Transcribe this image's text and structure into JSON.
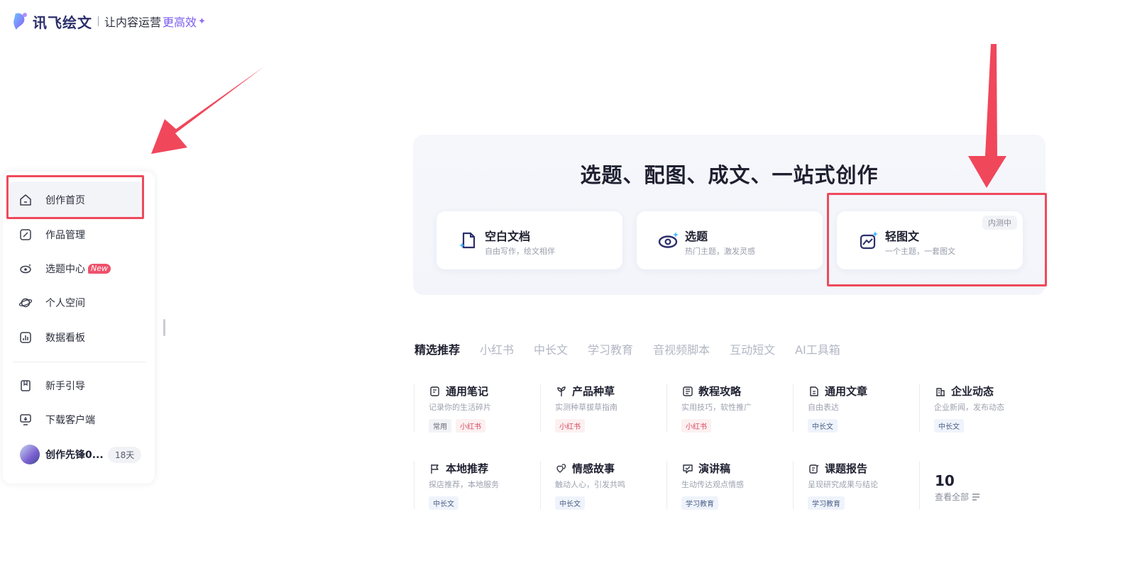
{
  "header": {
    "brand": "讯飞绘文",
    "slogan": "让内容运营",
    "slogan_highlight": "更高效",
    "sparkle": "✦"
  },
  "sidebar": {
    "items": [
      {
        "label": "创作首页",
        "icon": "home-icon",
        "active": true
      },
      {
        "label": "作品管理",
        "icon": "edit-icon"
      },
      {
        "label": "选题中心",
        "icon": "eye-sparkle-icon",
        "badge": "New"
      },
      {
        "label": "个人空间",
        "icon": "planet-icon"
      },
      {
        "label": "数据看板",
        "icon": "chart-icon"
      },
      {
        "label": "新手引导",
        "icon": "book-icon"
      },
      {
        "label": "下载客户端",
        "icon": "download-monitor-icon"
      }
    ],
    "user": {
      "name": "创作先锋0...",
      "days": "18天"
    }
  },
  "hero": {
    "title": "选题、配图、成文、一站式创作",
    "cards": [
      {
        "title": "空白文档",
        "subtitle": "自由写作，绘文相伴",
        "icon": "blank-doc-icon"
      },
      {
        "title": "选题",
        "subtitle": "热门主题，激发灵感",
        "icon": "eye-sparkle-icon"
      },
      {
        "title": "轻图文",
        "subtitle": "一个主题，一套图文",
        "icon": "image-sparkle-icon",
        "tag": "内测中"
      }
    ]
  },
  "tabs": [
    "精选推荐",
    "小红书",
    "中长文",
    "学习教育",
    "音视频脚本",
    "互动短文",
    "AI工具箱"
  ],
  "templates": [
    {
      "name": "通用笔记",
      "desc": "记录你的生活碎片",
      "tags": [
        {
          "t": "常用",
          "c": "gray"
        },
        {
          "t": "小红书",
          "c": "red"
        }
      ],
      "icon": "note-icon"
    },
    {
      "name": "产品种草",
      "desc": "实测种草拔草指南",
      "tags": [
        {
          "t": "小红书",
          "c": "red"
        }
      ],
      "icon": "sprout-icon"
    },
    {
      "name": "教程攻略",
      "desc": "实用技巧，软性推广",
      "tags": [
        {
          "t": "小红书",
          "c": "red"
        }
      ],
      "icon": "list-doc-icon"
    },
    {
      "name": "通用文章",
      "desc": "自由表达",
      "tags": [
        {
          "t": "中长文",
          "c": "blue"
        }
      ],
      "icon": "article-icon"
    },
    {
      "name": "企业动态",
      "desc": "企业新闻，发布动态",
      "tags": [
        {
          "t": "中长文",
          "c": "blue"
        }
      ],
      "icon": "building-icon"
    },
    {
      "name": "本地推荐",
      "desc": "探店推荐，本地服务",
      "tags": [
        {
          "t": "中长文",
          "c": "blue"
        }
      ],
      "icon": "flag-icon"
    },
    {
      "name": "情感故事",
      "desc": "触动人心，引发共鸣",
      "tags": [
        {
          "t": "中长文",
          "c": "blue"
        }
      ],
      "icon": "hearts-icon"
    },
    {
      "name": "演讲稿",
      "desc": "生动传达观点情感",
      "tags": [
        {
          "t": "学习教育",
          "c": "blue"
        }
      ],
      "icon": "speech-icon"
    },
    {
      "name": "课题报告",
      "desc": "呈现研究成果与结论",
      "tags": [
        {
          "t": "学习教育",
          "c": "blue"
        }
      ],
      "icon": "report-icon"
    }
  ],
  "more": {
    "count": "10",
    "label": "查看全部"
  },
  "colors": {
    "accent": "#7b5cf0",
    "annotation": "#ee4a5c",
    "brand": "#2c2f6b"
  }
}
